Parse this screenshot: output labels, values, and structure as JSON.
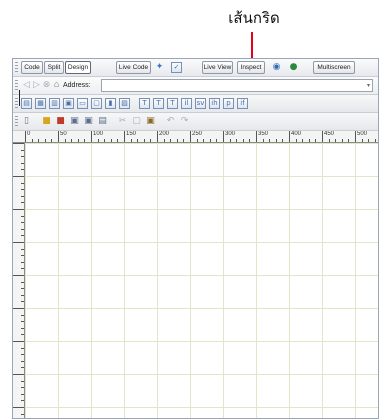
{
  "callout": {
    "label": "เส้นกริด",
    "color": "#e60018"
  },
  "toolbar": {
    "view_buttons": [
      "Code",
      "Split",
      "Design"
    ],
    "active_view": "Design",
    "live_code_label": "Live Code",
    "live_view_label": "Live View",
    "inspect_label": "Inspect",
    "multiscreen_label": "Multiscreen"
  },
  "address_bar": {
    "label": "Address:",
    "value": ""
  },
  "format_toolbar": {
    "icons": [
      "T",
      "T",
      "T",
      "il",
      "sv",
      "ih",
      "p",
      "if"
    ]
  },
  "ruler": {
    "h_labels": [
      "50",
      "100",
      "150",
      "200",
      "250",
      "300",
      "350",
      "400",
      "450",
      "500"
    ]
  },
  "canvas": {
    "grid": true,
    "grid_color": "#dfe7c7"
  }
}
